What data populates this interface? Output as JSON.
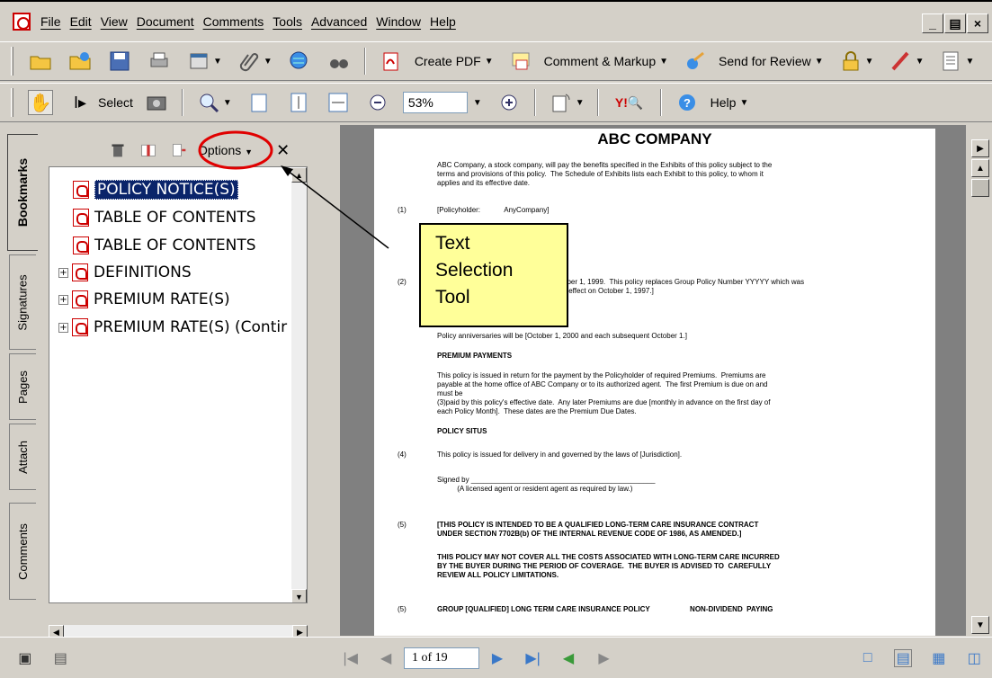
{
  "menu": {
    "items": [
      "File",
      "Edit",
      "View",
      "Document",
      "Comments",
      "Tools",
      "Advanced",
      "Window",
      "Help"
    ]
  },
  "toolbar1": {
    "create_pdf": "Create PDF",
    "comment_markup": "Comment & Markup",
    "send_review": "Send for Review"
  },
  "toolbar2": {
    "select_label": "Select",
    "zoom_value": "53%",
    "help_label": "Help"
  },
  "sidebar": {
    "tabs": [
      "Bookmarks",
      "Signatures",
      "Pages",
      "Attach",
      "Comments"
    ],
    "options_label": "Options",
    "bookmarks": [
      {
        "label": "POLICY NOTICE(S)",
        "expandable": false,
        "selected": true
      },
      {
        "label": "TABLE OF CONTENTS",
        "expandable": false,
        "selected": false
      },
      {
        "label": "TABLE OF CONTENTS",
        "expandable": false,
        "selected": false
      },
      {
        "label": "DEFINITIONS",
        "expandable": true,
        "selected": false
      },
      {
        "label": "PREMIUM RATE(S)",
        "expandable": true,
        "selected": false
      },
      {
        "label": "PREMIUM RATE(S) (Contir",
        "expandable": true,
        "selected": false
      }
    ]
  },
  "document": {
    "title": "ABC COMPANY",
    "lines": [
      {
        "num": "",
        "text": "ABC Company, a stock company, will pay the benefits specified in the Exhibits of this policy subject to the",
        "bold": false
      },
      {
        "num": "",
        "text": "terms and provisions of this policy.  The Schedule of Exhibits lists each Exhibit to this policy, to whom it",
        "bold": false
      },
      {
        "num": "",
        "text": "applies and its effective date.",
        "bold": false
      },
      {
        "num": "(1)",
        "text": "[Policyholder:            AnyCompany]",
        "bold": false
      },
      {
        "num": "",
        "text": "]",
        "bold": false
      },
      {
        "num": "(2)",
        "text": "ober 1, 1999.  This policy replaces Group Policy Number YYYYY which was",
        "bold": false
      },
      {
        "num": "",
        "text": "k effect on October 1, 1997.]",
        "bold": false
      },
      {
        "num": "",
        "text": "Policy anniversaries will be [October 1, 2000 and each subsequent October 1.]",
        "bold": false
      },
      {
        "num": "",
        "text": "PREMIUM PAYMENTS",
        "bold": true
      },
      {
        "num": "",
        "text": "This policy is issued in return for the payment by the Policyholder of required Premiums.  Premiums are",
        "bold": false
      },
      {
        "num": "",
        "text": "payable at the home office of ABC Company or to its authorized agent.  The first Premium is due on and",
        "bold": false
      },
      {
        "num": "",
        "text": "must be",
        "bold": false
      },
      {
        "num": "",
        "text": "(3)paid by this policy's effective date.  Any later Premiums are due [monthly in advance on the first day of",
        "bold": false
      },
      {
        "num": "",
        "text": "each Policy Month].  These dates are the Premium Due Dates.",
        "bold": false
      },
      {
        "num": "",
        "text": "POLICY SITUS",
        "bold": true
      },
      {
        "num": "(4)",
        "text": "This policy is issued for delivery in and governed by the laws of [Jurisdiction].",
        "bold": false
      },
      {
        "num": "",
        "text": "Signed by ______________________________________________",
        "bold": false
      },
      {
        "num": "",
        "text": "          (A licensed agent or resident agent as required by law.)",
        "bold": false
      },
      {
        "num": "(5)",
        "text": "[THIS POLICY IS INTENDED TO BE A QUALIFIED LONG-TERM CARE INSURANCE CONTRACT",
        "bold": true
      },
      {
        "num": "",
        "text": "UNDER SECTION 7702B(b) OF THE INTERNAL REVENUE CODE OF 1986, AS AMENDED.]",
        "bold": true
      },
      {
        "num": "",
        "text": "THIS POLICY MAY NOT COVER ALL THE COSTS ASSOCIATED WITH LONG-TERM CARE INCURRED",
        "bold": true
      },
      {
        "num": "",
        "text": "BY THE BUYER DURING THE PERIOD OF COVERAGE.  THE BUYER IS ADVISED TO  CAREFULLY",
        "bold": true
      },
      {
        "num": "",
        "text": "REVIEW ALL POLICY LIMITATIONS.",
        "bold": true
      },
      {
        "num": "(5)",
        "text": "GROUP [QUALIFIED] LONG TERM CARE INSURANCE POLICY                    NON-DIVIDEND  PAYING",
        "bold": true
      }
    ]
  },
  "callout": {
    "text": "Text\nSelection\nTool"
  },
  "status": {
    "page_indicator": "1 of 19"
  },
  "colors": {
    "highlight": "#0a246a",
    "callout_bg": "#ffff99",
    "circle": "#e00000"
  }
}
